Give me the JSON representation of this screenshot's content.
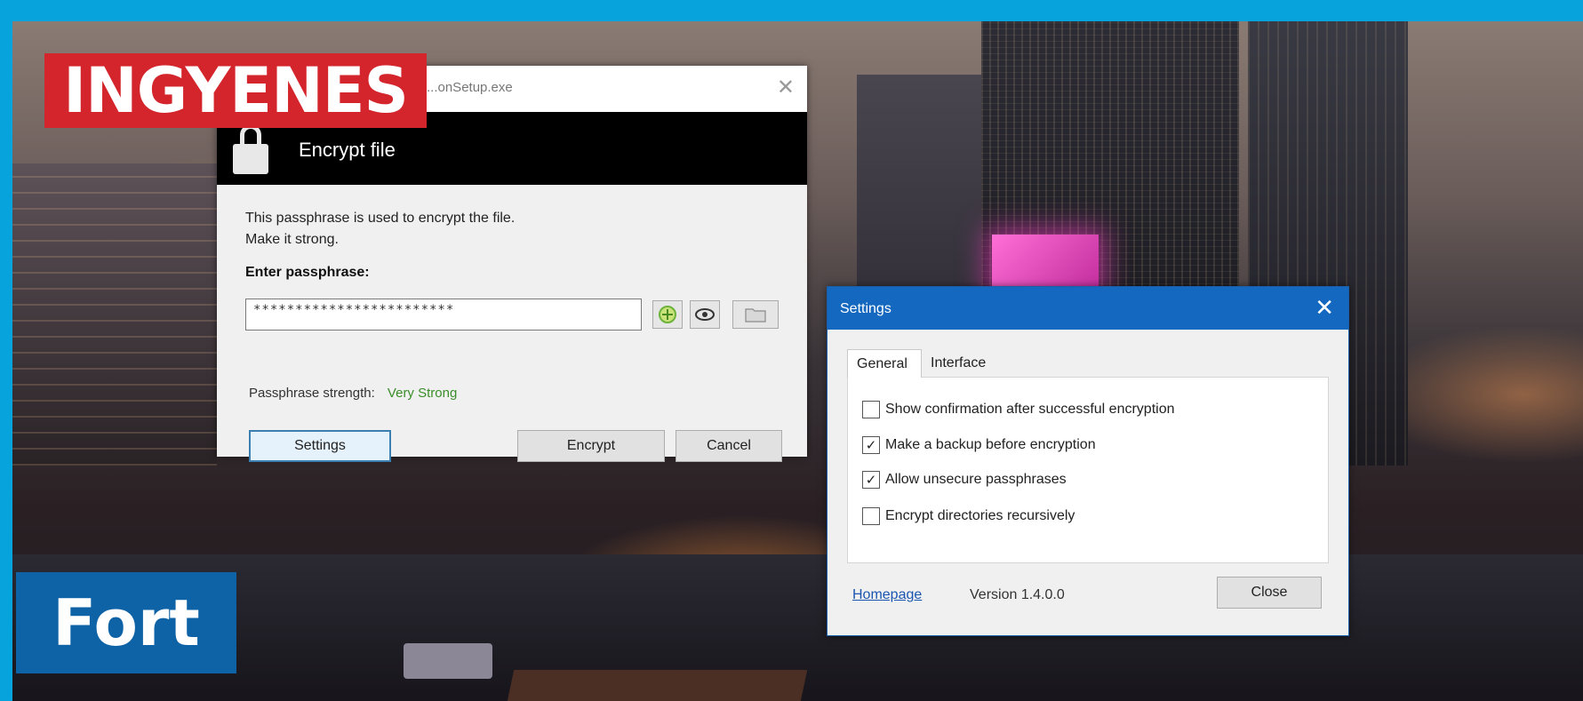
{
  "badges": {
    "top": "INGYENES",
    "bottom": "Fort"
  },
  "encrypt_dialog": {
    "window_title": "...onSetup.exe",
    "close_glyph": "✕",
    "header_title": "Encrypt file",
    "description_line1": "This passphrase is used to encrypt the file.",
    "description_line2": "Make it strong.",
    "passphrase_label": "Enter passphrase:",
    "passphrase_value": "************************",
    "strength_label": "Passphrase strength:",
    "strength_value": "Very Strong",
    "strength_color": "#3b8e2b",
    "buttons": {
      "settings": "Settings",
      "encrypt": "Encrypt",
      "cancel": "Cancel"
    },
    "icons": [
      "lock-icon",
      "generate-passphrase-icon",
      "show-passphrase-eye-icon",
      "folder-icon"
    ]
  },
  "settings_dialog": {
    "title": "Settings",
    "close_glyph": "✕",
    "title_bar_color": "#1468c0",
    "tabs": [
      "General",
      "Interface"
    ],
    "active_tab": "General",
    "options": [
      {
        "label": "Show confirmation after successful encryption",
        "checked": false
      },
      {
        "label": "Make a backup before encryption",
        "checked": true
      },
      {
        "label": "Allow unsecure passphrases",
        "checked": true
      },
      {
        "label": "Encrypt directories recursively",
        "checked": false
      }
    ],
    "homepage_link": "Homepage",
    "version": "Version 1.4.0.0",
    "close_button": "Close"
  },
  "frame_color": "#06a3dc"
}
